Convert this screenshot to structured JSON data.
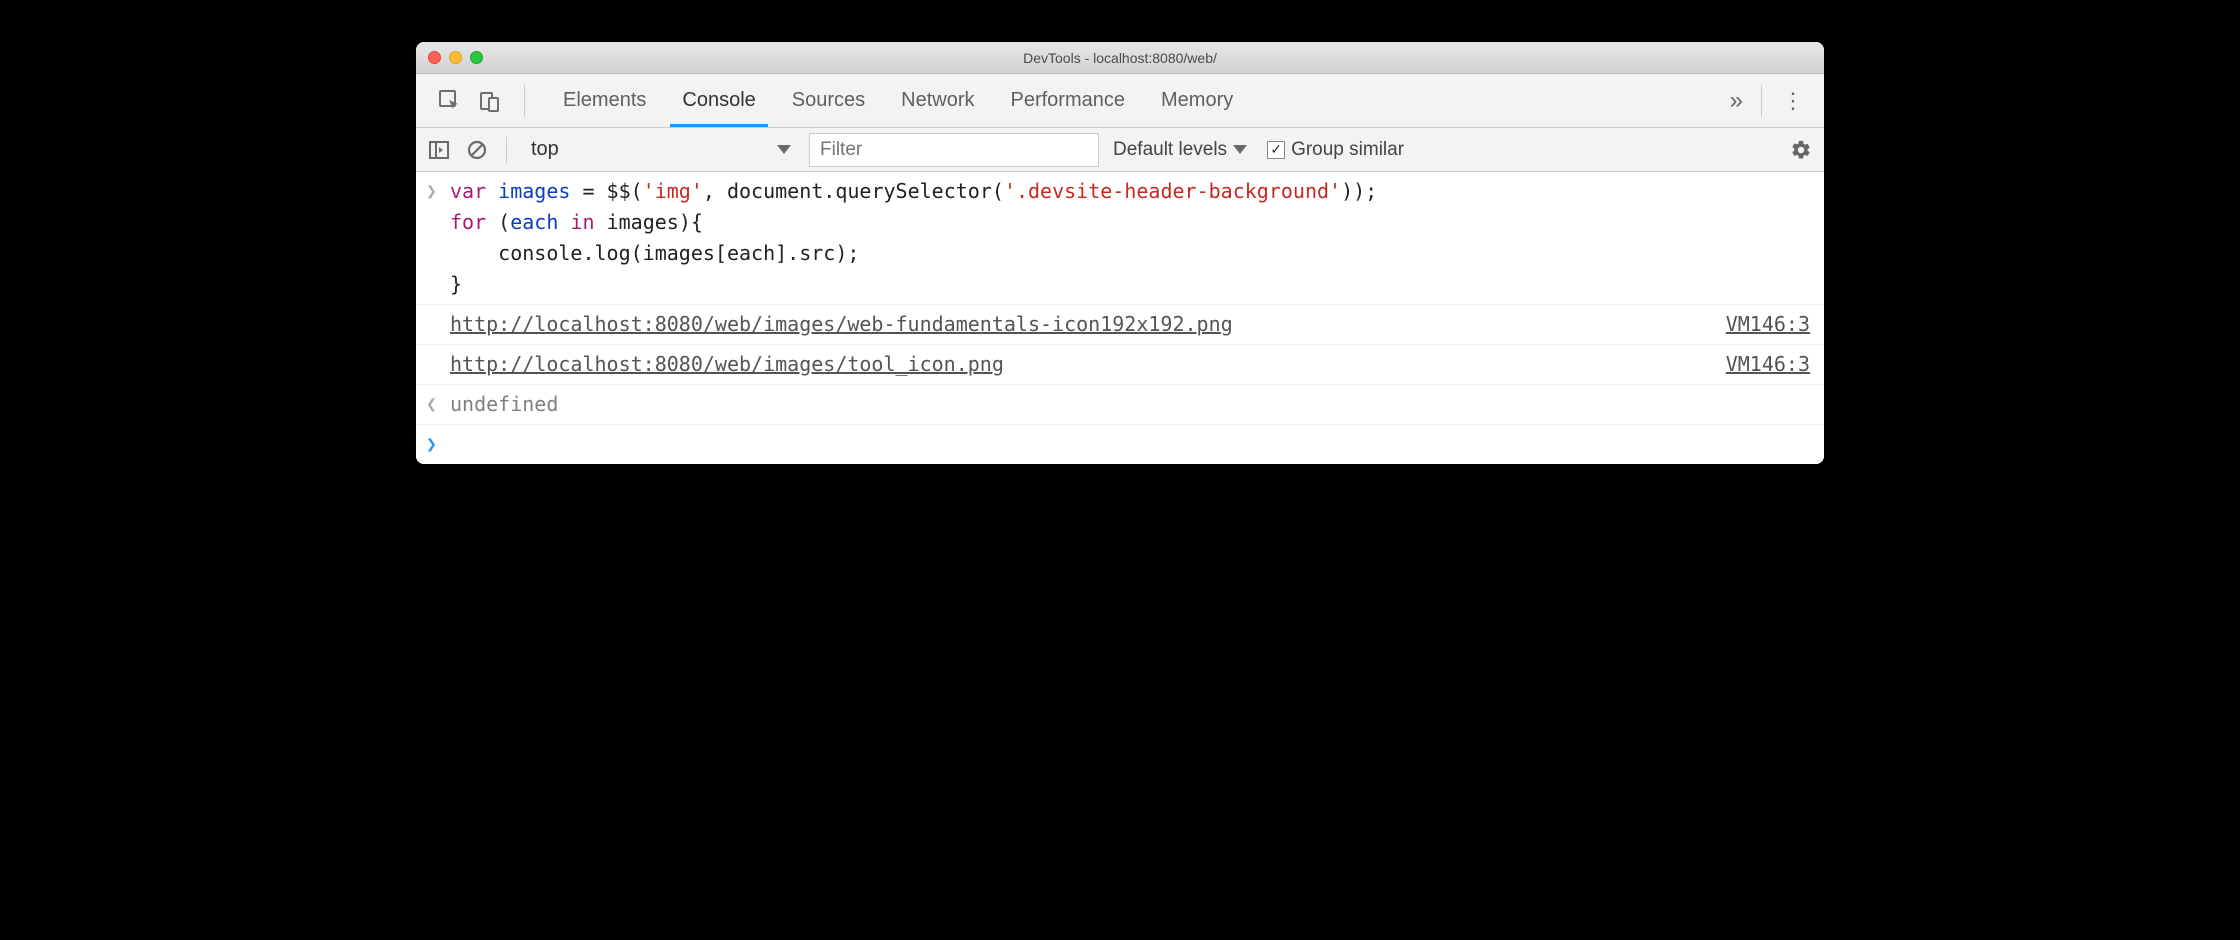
{
  "window": {
    "title": "DevTools - localhost:8080/web/"
  },
  "tabs": {
    "items": [
      "Elements",
      "Console",
      "Sources",
      "Network",
      "Performance",
      "Memory"
    ],
    "active": "Console",
    "more_glyph": "»",
    "kebab_glyph": "⋮"
  },
  "subtoolbar": {
    "context": "top",
    "filter_placeholder": "Filter",
    "levels_label": "Default levels",
    "group_similar_label": "Group similar",
    "group_similar_checked": true
  },
  "console": {
    "input_marker": "❯",
    "output_marker": "❮",
    "prompt_marker": "❯",
    "code_tokens": {
      "l1": {
        "t1": "var",
        "t2": " ",
        "t3": "images",
        "t4": " = $$(",
        "t5": "'img'",
        "t6": ", document.querySelector(",
        "t7": "'.devsite-header-background'",
        "t8": "));"
      },
      "l2": {
        "t1": "for",
        "t2": " (",
        "t3": "each",
        "t4": " ",
        "t5": "in",
        "t6": " images){"
      },
      "l3": {
        "t1": "    console.log(images[each].src);"
      },
      "l4": {
        "t1": "}"
      }
    },
    "logs": [
      {
        "text": "http://localhost:8080/web/images/web-fundamentals-icon192x192.png",
        "source": "VM146:3"
      },
      {
        "text": "http://localhost:8080/web/images/tool_icon.png",
        "source": "VM146:3"
      }
    ],
    "result": "undefined"
  }
}
